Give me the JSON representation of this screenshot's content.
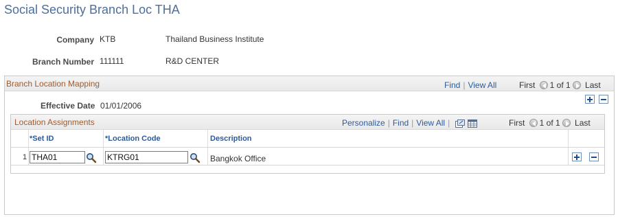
{
  "page": {
    "title": "Social Security Branch Loc THA"
  },
  "header": {
    "company_label": "Company",
    "company_code": "KTB",
    "company_name": "Thailand Business Institute",
    "branch_label": "Branch Number",
    "branch_number": "111111",
    "branch_name": "R&D CENTER"
  },
  "branch_mapping": {
    "title": "Branch Location Mapping",
    "find": "Find",
    "view_all": "View All",
    "first": "First",
    "range": "1 of 1",
    "last": "Last",
    "effective_date_label": "Effective Date",
    "effective_date": "01/01/2006"
  },
  "assignments": {
    "title": "Location Assignments",
    "personalize": "Personalize",
    "find": "Find",
    "view_all": "View All",
    "first": "First",
    "range": "1 of 1",
    "last": "Last",
    "columns": [
      "*Set ID",
      "*Location Code",
      "Description"
    ],
    "rows": [
      {
        "num": "1",
        "set_id": "THA01",
        "location_code": "KTRG01",
        "description": "Bangkok Office"
      }
    ]
  },
  "icons": {
    "prev": "previous-arrow-icon",
    "next": "next-arrow-icon",
    "lookup": "magnifier-icon",
    "add": "plus-icon",
    "delete": "minus-icon",
    "zoom": "new-window-icon",
    "download": "grid-download-icon"
  },
  "colors": {
    "title": "#4d6e9c",
    "section_title": "#a05a2c",
    "link": "#2b5a9c",
    "border": "#c9c9c9"
  }
}
